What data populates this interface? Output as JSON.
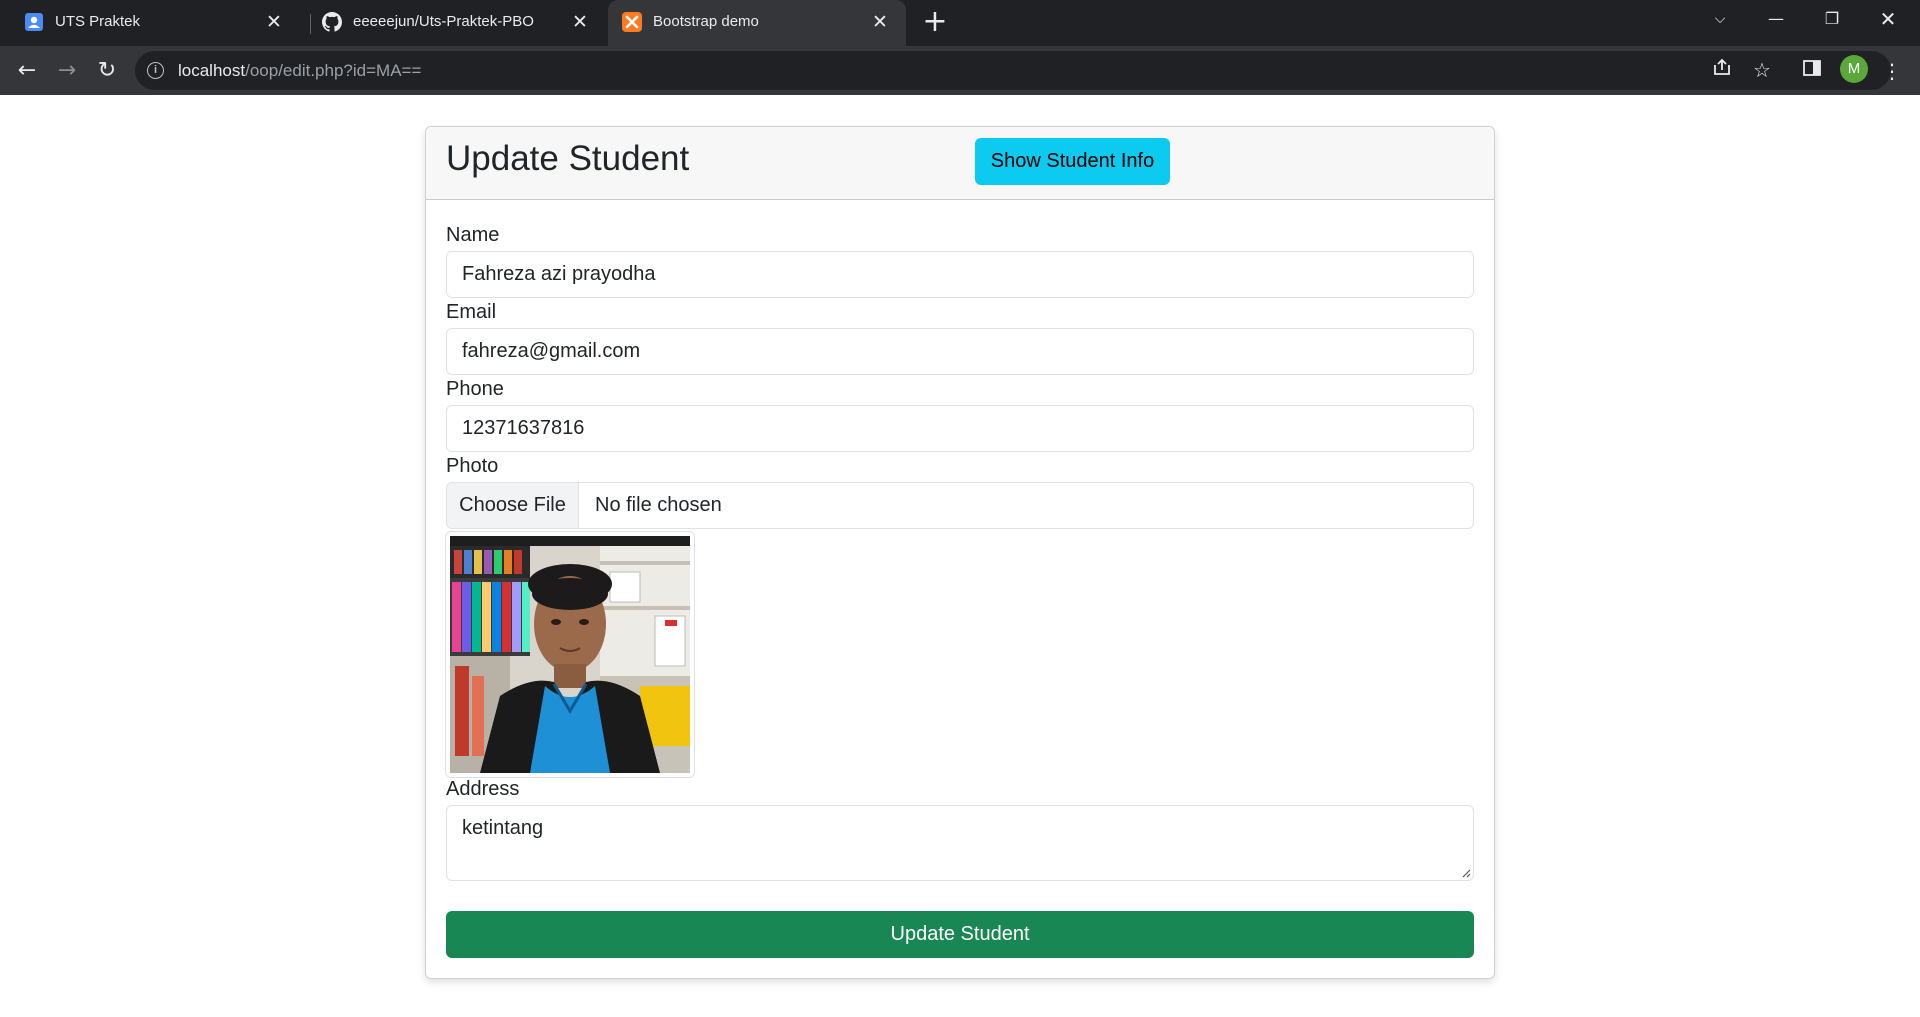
{
  "browser": {
    "tabs": [
      {
        "title": "UTS Praktek",
        "icon": "account-box-icon"
      },
      {
        "title": "eeeeejun/Uts-Praktek-PBO",
        "icon": "github-icon"
      },
      {
        "title": "Bootstrap demo",
        "icon": "xampp-icon",
        "active": true
      }
    ],
    "url_host": "localhost",
    "url_path": "/oop/edit.php?id=MA==",
    "profile_initial": "M"
  },
  "page": {
    "title": "Update Student",
    "show_info_label": "Show Student Info",
    "form": {
      "name_label": "Name",
      "name_value": "Fahreza azi prayodha",
      "email_label": "Email",
      "email_value": "fahreza@gmail.com",
      "phone_label": "Phone",
      "phone_value": "12371637816",
      "photo_label": "Photo",
      "file_button_label": "Choose File",
      "file_status": "No file chosen",
      "address_label": "Address",
      "address_value": "ketintang",
      "submit_label": "Update Student"
    }
  },
  "colors": {
    "info_button": "#0dcaf0",
    "success_button": "#198754"
  }
}
